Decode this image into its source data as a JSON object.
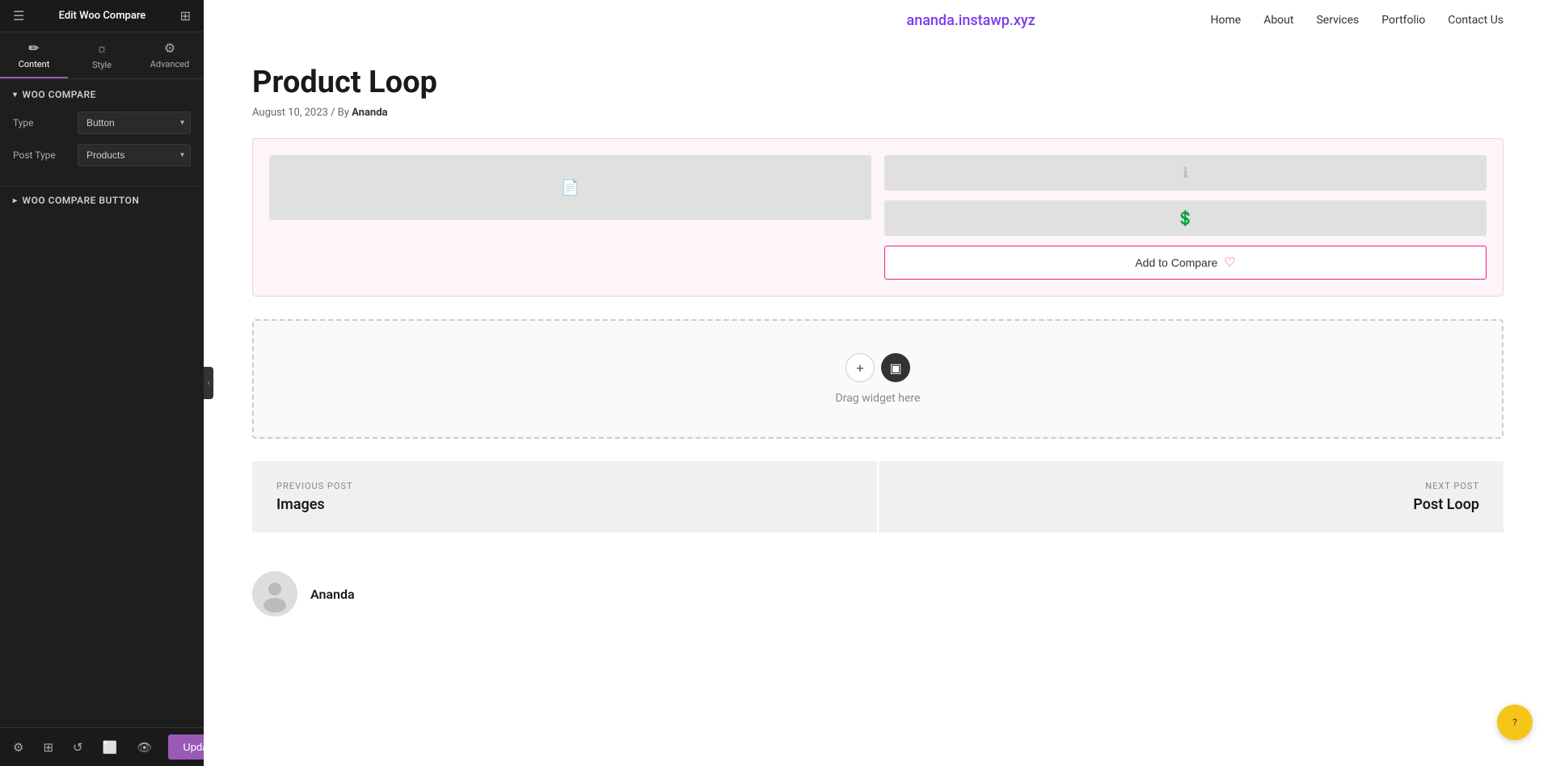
{
  "sidebar": {
    "header": {
      "title": "Edit Woo Compare",
      "hamburger": "☰",
      "grid": "⊞"
    },
    "tabs": [
      {
        "id": "content",
        "label": "Content",
        "icon": "✏️",
        "active": true
      },
      {
        "id": "style",
        "label": "Style",
        "icon": "🎨",
        "active": false
      },
      {
        "id": "advanced",
        "label": "Advanced",
        "icon": "⚙️",
        "active": false
      }
    ],
    "woo_compare_section": {
      "title": "Woo Compare",
      "type_label": "Type",
      "type_value": "Button",
      "post_type_label": "Post Type",
      "post_type_value": "Products"
    },
    "woo_compare_button_section": {
      "title": "Woo Compare Button"
    },
    "bottom": {
      "update_label": "Update",
      "arrow_label": "▲"
    }
  },
  "main": {
    "nav": {
      "site_url": "ananda.instawp.xyz",
      "links": [
        "Home",
        "About",
        "Services",
        "Portfolio",
        "Contact Us"
      ]
    },
    "post": {
      "title": "Product Loop",
      "meta": "August 10, 2023  /  By ",
      "author_name": "Ananda",
      "post_nav": {
        "previous_label": "PREVIOUS POST",
        "previous_title": "Images",
        "next_label": "NEXT POST",
        "next_title": "Post Loop"
      }
    },
    "product_area": {
      "add_to_compare_text": "Add to Compare",
      "heart_icon": "♡"
    },
    "drag_widget": {
      "text": "Drag widget here"
    },
    "author": {
      "name": "Ananda"
    },
    "floating_btn": "●"
  }
}
